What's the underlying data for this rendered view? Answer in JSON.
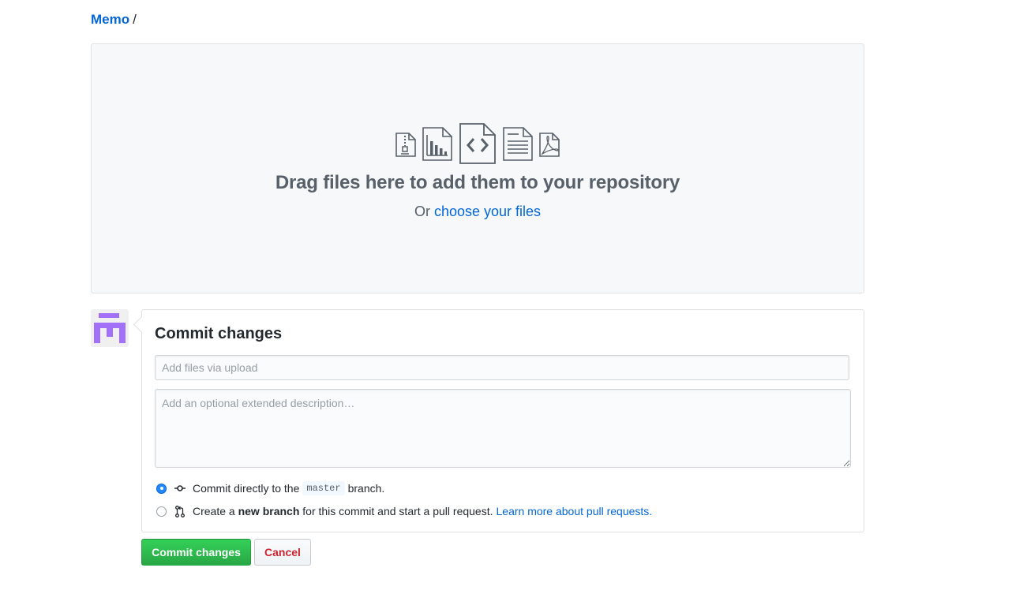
{
  "breadcrumb": {
    "repo": "Memo",
    "separator": "/"
  },
  "dropzone": {
    "icons": [
      "file-zip-icon",
      "graph-icon",
      "file-code-icon",
      "file-text-icon",
      "file-pdf-icon"
    ],
    "title": "Drag files here to add them to your repository",
    "prefix": "Or",
    "link": "choose your files"
  },
  "commit": {
    "title": "Commit changes",
    "summary_placeholder": "Add files via upload",
    "description_placeholder": "Add an optional extended description…",
    "option_direct": {
      "before": "Commit directly to the",
      "branch": "master",
      "after": "branch.",
      "selected": true
    },
    "option_new_branch": {
      "before": "Create a",
      "bold": "new branch",
      "after": "for this commit and start a pull request.",
      "link": "Learn more about pull requests.",
      "selected": false
    }
  },
  "buttons": {
    "commit": "Commit changes",
    "cancel": "Cancel"
  },
  "colors": {
    "accent": "#0366d6",
    "primary_button": "#28a745",
    "cancel_text": "#cb2431",
    "avatar": "#a371f7"
  }
}
